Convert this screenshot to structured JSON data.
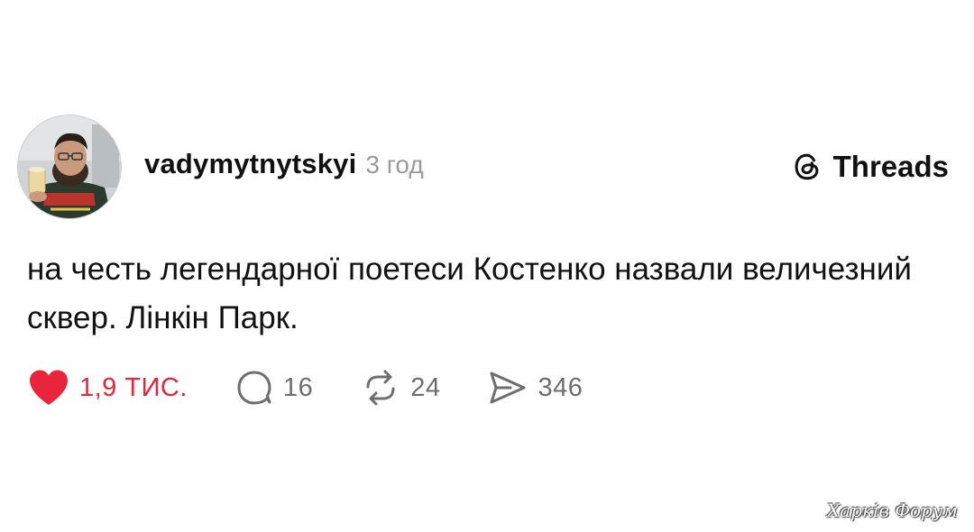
{
  "post": {
    "author": {
      "username": "vadymytnytskyi",
      "avatar_icon": "user-photo-avatar"
    },
    "time_ago": "3 год",
    "brand": {
      "name": "Threads",
      "icon": "threads-logo-icon"
    },
    "text": "на честь легендарної поетеси Костенко назвали величезний сквер. Лінкін Парк.",
    "actions": {
      "likes": {
        "icon": "heart-icon",
        "count": "1,9 ТИС.",
        "liked": true,
        "color": "#e8253a"
      },
      "comments": {
        "icon": "comment-icon",
        "count": "16"
      },
      "reposts": {
        "icon": "repost-icon",
        "count": "24"
      },
      "shares": {
        "icon": "send-icon",
        "count": "346"
      }
    }
  },
  "watermark": "Харків Форум"
}
